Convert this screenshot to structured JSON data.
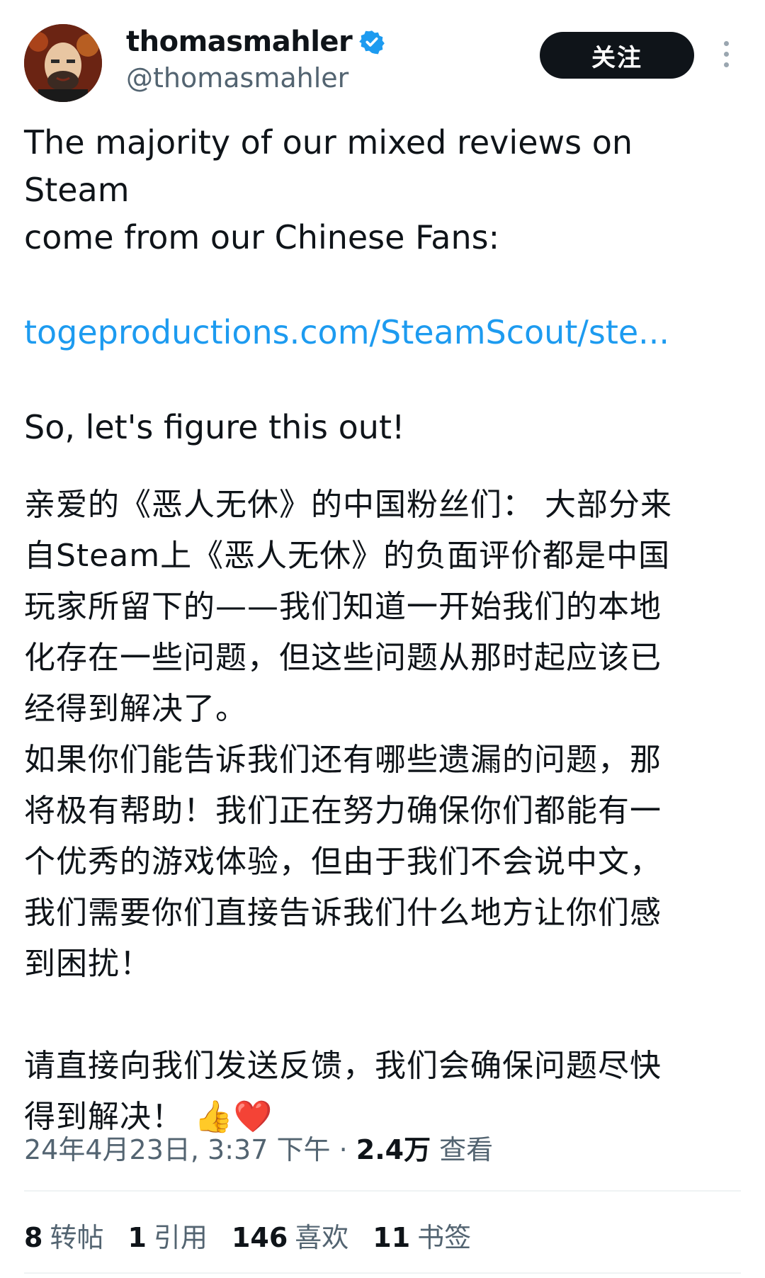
{
  "author": {
    "display_name": "thomasmahler",
    "handle": "@thomasmahler",
    "verified": true
  },
  "actions": {
    "follow_label": "关注",
    "more_icon": "more-vertical-icon"
  },
  "tweet": {
    "line1": "The majority of our mixed reviews on Steam",
    "line2": "come from our Chinese Fans:",
    "link": "togeproductions.com/SteamScout/ste...",
    "line3": "So, let's figure this out!",
    "zh_lines": [
      "亲爱的《恶人无休》的中国粉丝们： 大部分来",
      "自Steam上《恶人无休》的负面评价都是中国",
      "玩家所留下的——我们知道一开始我们的本地",
      "化存在一些问题，但这些问题从那时起应该已",
      "经得到解决了。",
      "如果你们能告诉我们还有哪些遗漏的问题，那",
      "将极有帮助！我们正在努力确保你们都能有一",
      "个优秀的游戏体验，但由于我们不会说中文，",
      "我们需要你们直接告诉我们什么地方让你们感",
      "到困扰！"
    ],
    "zh_final_1": "请直接向我们发送反馈，我们会确保问题尽快",
    "zh_final_2": "得到解决！",
    "emoji": "👍❤️"
  },
  "meta": {
    "timestamp": "24年4月23日, 3:37 下午",
    "separator": "·",
    "views_count": "2.4万",
    "views_label": "查看"
  },
  "stats": [
    {
      "count": "8",
      "label": "转帖"
    },
    {
      "count": "1",
      "label": "引用"
    },
    {
      "count": "146",
      "label": "喜欢"
    },
    {
      "count": "11",
      "label": "书签"
    }
  ],
  "colors": {
    "link": "#1d9bf0",
    "verified": "#1d9bf0",
    "muted_text": "#536471",
    "button_bg": "#0f1419"
  }
}
